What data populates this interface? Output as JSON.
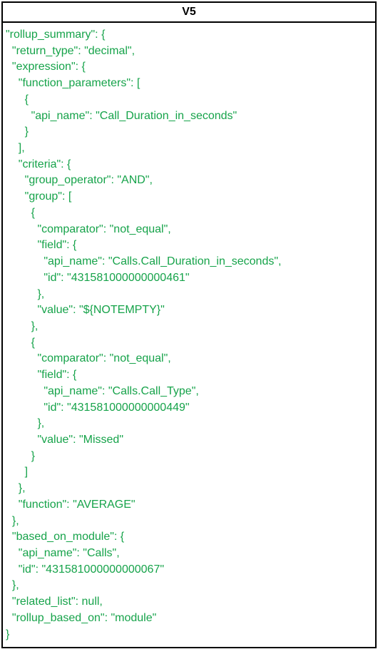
{
  "header": {
    "title": "V5"
  },
  "code": {
    "content": "\"rollup_summary\": {\n  \"return_type\": \"decimal\",\n  \"expression\": {\n    \"function_parameters\": [\n      {\n        \"api_name\": \"Call_Duration_in_seconds\"\n      }\n    ],\n    \"criteria\": {\n      \"group_operator\": \"AND\",\n      \"group\": [\n        {\n          \"comparator\": \"not_equal\",\n          \"field\": {\n            \"api_name\": \"Calls.Call_Duration_in_seconds\",\n            \"id\": \"431581000000000461\"\n          },\n          \"value\": \"${NOTEMPTY}\"\n        },\n        {\n          \"comparator\": \"not_equal\",\n          \"field\": {\n            \"api_name\": \"Calls.Call_Type\",\n            \"id\": \"431581000000000449\"\n          },\n          \"value\": \"Missed\"\n        }\n      ]\n    },\n    \"function\": \"AVERAGE\"\n  },\n  \"based_on_module\": {\n    \"api_name\": \"Calls\",\n    \"id\": \"431581000000000067\"\n  },\n  \"related_list\": null,\n  \"rollup_based_on\": \"module\"\n}"
  }
}
